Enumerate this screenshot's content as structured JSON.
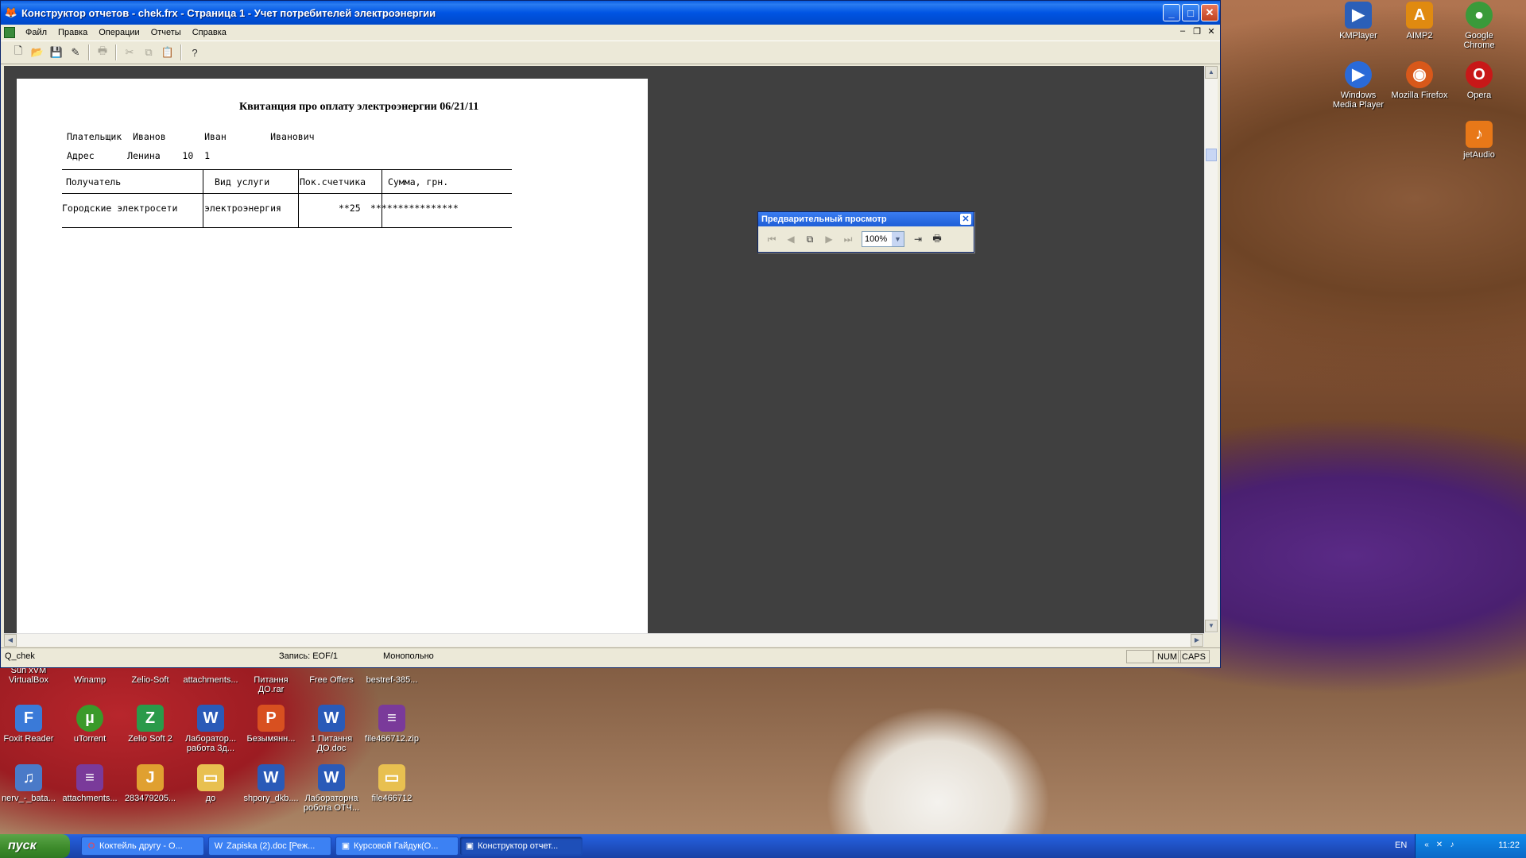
{
  "window": {
    "title": "Конструктор отчетов - chek.frx - Страница 1 - Учет потребителей электроэнергии",
    "menu": [
      "Файл",
      "Правка",
      "Операции",
      "Отчеты",
      "Справка"
    ]
  },
  "report": {
    "title": "Квитанция про оплату электроэнергии  06/21/11",
    "payer_line": "Плательщик  Иванов       Иван        Иванович",
    "address_line": "Адрес      Ленина    10  1",
    "columns": [
      "Получатель",
      "Вид услуги",
      "Пок.счетчика",
      "Сумма, грн."
    ],
    "row": {
      "recipient": "Городские электросети",
      "service": "электроэнергия",
      "meter": "**25",
      "sum": "****************"
    }
  },
  "preview_toolbar": {
    "title": "Предварительный просмотр",
    "zoom": "100%"
  },
  "statusbar": {
    "alias": "Q_chek",
    "record": "Запись: EOF/1",
    "mode": "Монопольно",
    "num": "NUM",
    "caps": "CAPS"
  },
  "desktop_icons": [
    {
      "label": "KMPlayer",
      "icon": "kmplayer-icon",
      "color": "#2b5fb8"
    },
    {
      "label": "AIMP2",
      "icon": "aimp-icon",
      "color": "#e08a10"
    },
    {
      "label": "Google Chrome",
      "icon": "chrome-icon",
      "color": "#3a9a3a"
    },
    {
      "label": "Windows Media Player",
      "icon": "wmp-icon",
      "color": "#2a6ad8"
    },
    {
      "label": "Mozilla Firefox",
      "icon": "firefox-icon",
      "color": "#d8581a"
    },
    {
      "label": "Opera",
      "icon": "opera-icon",
      "color": "#c81818"
    },
    {
      "label": "jetAudio",
      "icon": "jetaudio-icon",
      "color": "#e87818"
    },
    {
      "label": "Sun xVM VirtualBox",
      "icon": "virtualbox-icon",
      "color": "#3a6ac8"
    },
    {
      "label": "Winamp",
      "icon": "winamp-icon",
      "color": "#e07820"
    },
    {
      "label": "Zelio-Soft",
      "icon": "zelio-icon",
      "color": "#2a9a4a"
    },
    {
      "label": "attachments...",
      "icon": "folder-icon",
      "color": "#e8c050"
    },
    {
      "label": "Питання ДО.rar",
      "icon": "rar-icon",
      "color": "#7a3a9a"
    },
    {
      "label": "Free Offers",
      "icon": "offers-icon",
      "color": "#5a7ab8"
    },
    {
      "label": "bestref-385...",
      "icon": "rar-icon",
      "color": "#7a3a9a"
    },
    {
      "label": "Foxit Reader",
      "icon": "foxit-icon",
      "color": "#3a7ad8"
    },
    {
      "label": "uTorrent",
      "icon": "utorrent-icon",
      "color": "#3a9a2a"
    },
    {
      "label": "Zelio Soft 2",
      "icon": "zelio-icon",
      "color": "#2a9a4a"
    },
    {
      "label": "Лаборатор... работа 3д...",
      "icon": "word-icon",
      "color": "#2a5ab8"
    },
    {
      "label": "Безымянн...",
      "icon": "png-icon",
      "color": "#d85020"
    },
    {
      "label": "1 Питання ДО.doc",
      "icon": "word-icon",
      "color": "#2a5ab8"
    },
    {
      "label": "file466712.zip",
      "icon": "rar-icon",
      "color": "#7a3a9a"
    },
    {
      "label": "nerv_-_bata...",
      "icon": "mp3-icon",
      "color": "#4a7ac8"
    },
    {
      "label": "attachments...",
      "icon": "rar-icon",
      "color": "#7a3a9a"
    },
    {
      "label": "283479205...",
      "icon": "jpg-icon",
      "color": "#e0a030"
    },
    {
      "label": "до",
      "icon": "folder-icon",
      "color": "#e8c050"
    },
    {
      "label": "shpory_dkb....",
      "icon": "word-icon",
      "color": "#2a5ab8"
    },
    {
      "label": "Лабораторна робота ОТЧ...",
      "icon": "word-icon",
      "color": "#2a5ab8"
    },
    {
      "label": "file466712",
      "icon": "folder-icon",
      "color": "#e8c050"
    }
  ],
  "taskbar": {
    "start": "пуск",
    "tasks": [
      {
        "label": "Коктейль другу - О...",
        "icon": "opera-icon"
      },
      {
        "label": "Zapiska (2).doc [Реж...",
        "icon": "word-icon"
      },
      {
        "label": "Курсовой Гайдук(О...",
        "icon": "foxpro-icon"
      },
      {
        "label": "Конструктор отчет...",
        "icon": "foxpro-icon"
      }
    ],
    "lang": "EN",
    "clock": "11:22"
  }
}
